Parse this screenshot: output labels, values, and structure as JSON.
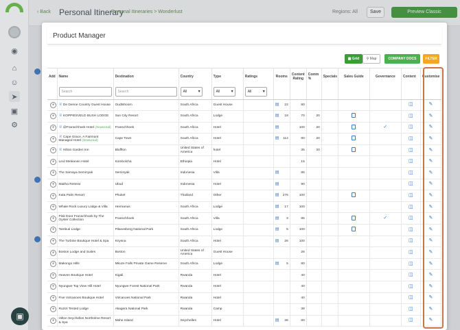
{
  "background": {
    "back_label": "Back",
    "itinerary_title": "Personal Itinerary",
    "breadcrumb": "Personal Itineraries  >  Wonderlust",
    "regions_label": "Regions: All",
    "save_label": "Save",
    "preview_label": "Preview Classic"
  },
  "modal": {
    "title": "Product Manager",
    "grid_label": "Grid",
    "map_label": "Map",
    "company_docs_label": "COMPANY DOCS",
    "filter_label": "FILTER"
  },
  "columns": {
    "add": "Add",
    "name": "Name",
    "destination": "Destination",
    "country": "Country",
    "type": "Type",
    "ratings": "Ratings",
    "rooms": "Rooms",
    "content_rating": "Content Rating",
    "comm": "Comm %",
    "specials": "Specials",
    "sales_guide": "Sales Guide",
    "governance": "Governance",
    "content": "Content",
    "customise": "Customise"
  },
  "filters": {
    "name_placeholder": "Search",
    "destination_placeholder": "Search",
    "country_value": "All",
    "type_value": "All",
    "ratings_value": "All"
  },
  "rows": [
    {
      "name": "De Denne Country Guest House",
      "seasonal": "",
      "crown": true,
      "destination": "Oudtshoorn",
      "country": "South Africa",
      "type": "Guest House",
      "bed": true,
      "rooms": "22",
      "content_rating": "80",
      "comm": "",
      "sales_guide": false,
      "governance": false
    },
    {
      "name": "KOPPIESVELD BUSH LODGE",
      "seasonal": "",
      "crown": true,
      "destination": "Sun City Resort",
      "country": "South Africa",
      "type": "Lodge",
      "bed": true,
      "rooms": "18",
      "content_rating": "70",
      "comm": "20",
      "sales_guide": true,
      "governance": false
    },
    {
      "name": "@Franschhoek Hotel",
      "seasonal": "(Seasonal)",
      "crown": true,
      "destination": "Franschhoek",
      "country": "South Africa",
      "type": "Hotel",
      "bed": true,
      "rooms": "",
      "content_rating": "100",
      "comm": "20",
      "sales_guide": true,
      "governance": true
    },
    {
      "name": "Cape Grace, A Fairmont Managed Hotel",
      "seasonal": "(Seasonal)",
      "crown": true,
      "destination": "Cape Town",
      "country": "South Africa",
      "type": "Hotel",
      "bed": true,
      "rooms": "112",
      "content_rating": "80",
      "comm": "20",
      "sales_guide": true,
      "governance": false
    },
    {
      "name": "Hilton Garden Inn",
      "seasonal": "",
      "crown": true,
      "destination": "Bluffton",
      "country": "United States of America",
      "type": "hotel",
      "bed": false,
      "rooms": "",
      "content_rating": "35",
      "comm": "20",
      "sales_guide": true,
      "governance": false
    },
    {
      "name": "Leul Meleanen Hotel",
      "seasonal": "",
      "crown": false,
      "destination": "Kombolcha",
      "country": "Ethiopia",
      "type": "Hotel",
      "bed": false,
      "rooms": "",
      "content_rating": "15",
      "comm": "",
      "sales_guide": false,
      "governance": false
    },
    {
      "name": "The Samaya Seminyak",
      "seasonal": "",
      "crown": false,
      "destination": "Seminyak",
      "country": "Indonesia",
      "type": "Villa",
      "bed": true,
      "rooms": "",
      "content_rating": "85",
      "comm": "",
      "sales_guide": false,
      "governance": false
    },
    {
      "name": "Maitha Retreat",
      "seasonal": "",
      "crown": false,
      "destination": "Ubud",
      "country": "Indonesia",
      "type": "Hotel",
      "bed": true,
      "rooms": "",
      "content_rating": "90",
      "comm": "",
      "sales_guide": false,
      "governance": false
    },
    {
      "name": "Kata Palm Resort",
      "seasonal": "",
      "crown": false,
      "destination": "Phuket",
      "country": "Thailand",
      "type": "Other",
      "bed": true,
      "rooms": "276",
      "content_rating": "100",
      "comm": "",
      "sales_guide": true,
      "governance": false
    },
    {
      "name": "Whale Rock Luxury Lodge & Villa",
      "seasonal": "",
      "crown": false,
      "destination": "Hermanus",
      "country": "South Africa",
      "type": "Lodge",
      "bed": true,
      "rooms": "17",
      "content_rating": "100",
      "comm": "",
      "sales_guide": false,
      "governance": false
    },
    {
      "name": "Pink Door Franschhoek by The Oyster Collection",
      "seasonal": "",
      "crown": false,
      "destination": "Franschhoek",
      "country": "South Africa",
      "type": "Villa",
      "bed": true,
      "rooms": "3",
      "content_rating": "85",
      "comm": "",
      "sales_guide": true,
      "governance": true
    },
    {
      "name": "Tambuti Lodge",
      "seasonal": "",
      "crown": false,
      "destination": "Pilanesberg National Park",
      "country": "South Africa",
      "type": "Lodge",
      "bed": true,
      "rooms": "5",
      "content_rating": "100",
      "comm": "",
      "sales_guide": true,
      "governance": false
    },
    {
      "name": "The Turbine Boutique Hotel & Spa",
      "seasonal": "",
      "crown": false,
      "destination": "Knysna",
      "country": "South Africa",
      "type": "Hotel",
      "bed": true,
      "rooms": "26",
      "content_rating": "100",
      "comm": "",
      "sales_guide": false,
      "governance": false
    },
    {
      "name": "Boston Lodge and Suites",
      "seasonal": "",
      "crown": false,
      "destination": "Boston",
      "country": "United States of America",
      "type": "Guest House",
      "bed": false,
      "rooms": "",
      "content_rating": "26",
      "comm": "",
      "sales_guide": false,
      "governance": false
    },
    {
      "name": "Makongo Hills",
      "seasonal": "",
      "crown": false,
      "destination": "Mkuze Falls Private Game Reserve",
      "country": "South Africa",
      "type": "Lodge",
      "bed": true,
      "rooms": "5",
      "content_rating": "80",
      "comm": "",
      "sales_guide": false,
      "governance": false
    },
    {
      "name": "Heaven Boutique Hotel",
      "seasonal": "",
      "crown": false,
      "destination": "Kigali",
      "country": "Rwanda",
      "type": "Hotel",
      "bed": false,
      "rooms": "",
      "content_rating": "40",
      "comm": "",
      "sales_guide": false,
      "governance": false
    },
    {
      "name": "Nyungwe Top View Hill Hotel",
      "seasonal": "",
      "crown": false,
      "destination": "Nyungwe Forest National Park",
      "country": "Rwanda",
      "type": "Hotel",
      "bed": false,
      "rooms": "",
      "content_rating": "40",
      "comm": "",
      "sales_guide": false,
      "governance": false
    },
    {
      "name": "Five Volcanoes Boutique Hotel",
      "seasonal": "",
      "crown": false,
      "destination": "Volcanoes National Park",
      "country": "Rwanda",
      "type": "Hotel",
      "bed": false,
      "rooms": "",
      "content_rating": "40",
      "comm": "",
      "sales_guide": false,
      "governance": false
    },
    {
      "name": "Ruzizi Tented Lodge",
      "seasonal": "",
      "crown": false,
      "destination": "Akagera National Park",
      "country": "Rwanda",
      "type": "Camp",
      "bed": false,
      "rooms": "",
      "content_rating": "38",
      "comm": "",
      "sales_guide": false,
      "governance": false
    },
    {
      "name": "Hilton Seychelles Northolme Resort & Spa",
      "seasonal": "",
      "crown": false,
      "destination": "Mahe Island",
      "country": "Seychelles",
      "type": "Hotel",
      "bed": true,
      "rooms": "36",
      "content_rating": "80",
      "comm": "",
      "sales_guide": false,
      "governance": false
    }
  ]
}
